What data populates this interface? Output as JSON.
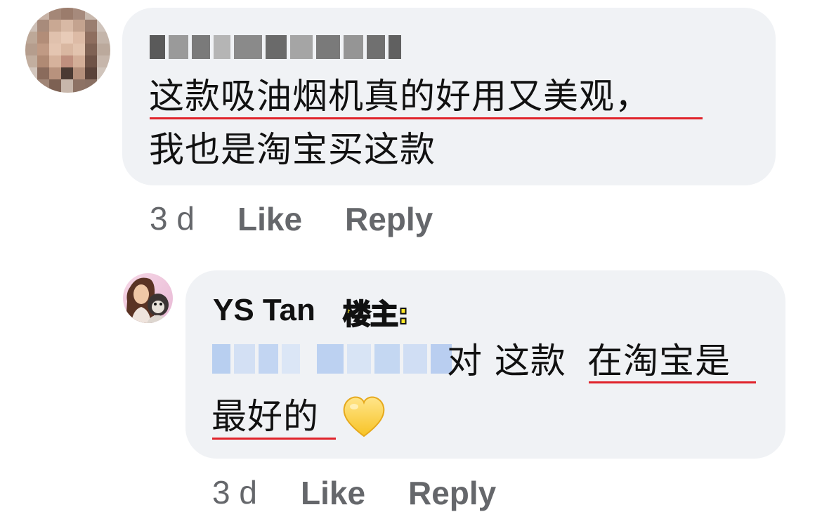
{
  "comment1": {
    "text_line1": "这款吸油烟机真的好用又美观，",
    "text_line2": "我也是淘宝买这款",
    "time": "3 d",
    "like_label": "Like",
    "reply_label": "Reply"
  },
  "comment2": {
    "author": "YS Tan",
    "badge": "楼主:",
    "text_part1": "对 这款",
    "text_part2": "在淘宝是",
    "text_line2": "最好的",
    "emoji": "💛",
    "time": "3 d",
    "like_label": "Like",
    "reply_label": "Reply"
  },
  "colors": {
    "bubble": "#f0f2f5",
    "underline": "#e0232b",
    "meta_text": "#65676b",
    "mention_blur": "#c9d9f2",
    "badge_fill": "#ffe72a"
  },
  "icons": {
    "avatar1": "pixelated-avatar",
    "avatar2": "user-photo-avatar",
    "emoji": "yellow-heart"
  }
}
